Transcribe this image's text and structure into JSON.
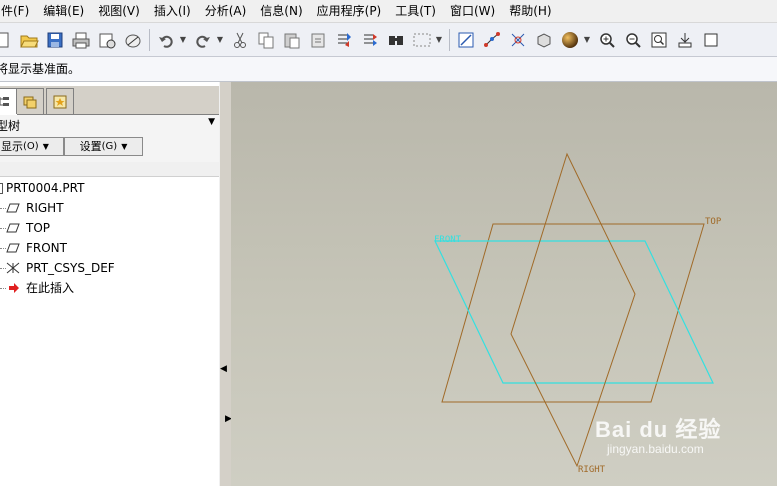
{
  "menubar": {
    "items": [
      "件(F)",
      "编辑(E)",
      "视图(V)",
      "插入(I)",
      "分析(A)",
      "信息(N)",
      "应用程序(P)",
      "工具(T)",
      "窗口(W)",
      "帮助(H)"
    ]
  },
  "toolbar": {
    "buttons": [
      "new-icon",
      "open-icon",
      "save-icon",
      "print-icon",
      "send-icon",
      "regen-icon",
      "undo-icon",
      "redo-icon",
      "cut-icon",
      "copy-icon",
      "paste-icon",
      "paste-special-icon",
      "regenerate-icon",
      "regen-manager-icon",
      "find-icon",
      "select-box-icon",
      "view-icon",
      "datum-axis-icon",
      "datum-point-icon",
      "saved-view-icon",
      "shading-icon",
      "zoom-in-icon",
      "zoom-out-icon",
      "refit-icon",
      "import-icon",
      "more-icon"
    ]
  },
  "message_line": {
    "text": "将显示基准面。"
  },
  "left_panel": {
    "title": "型树",
    "show_button": "显示",
    "show_key": "(O)",
    "settings_button": "设置",
    "settings_key": "(G)",
    "tree": {
      "root": "PRT0004.PRT",
      "items": [
        {
          "label": "RIGHT",
          "icon": "datum-plane-icon"
        },
        {
          "label": "TOP",
          "icon": "datum-plane-icon"
        },
        {
          "label": "FRONT",
          "icon": "datum-plane-icon"
        },
        {
          "label": "PRT_CSYS_DEF",
          "icon": "csys-icon"
        },
        {
          "label": "在此插入",
          "icon": "insert-arrow-icon"
        }
      ]
    }
  },
  "canvas": {
    "planes": [
      {
        "name": "FRONT",
        "color": "#33e0e0"
      },
      {
        "name": "TOP",
        "color": "#a06a28"
      },
      {
        "name": "RIGHT",
        "color": "#a06a28"
      }
    ]
  },
  "watermark": {
    "main": "Bai du 经验",
    "sub": "jingyan.baidu.com"
  }
}
